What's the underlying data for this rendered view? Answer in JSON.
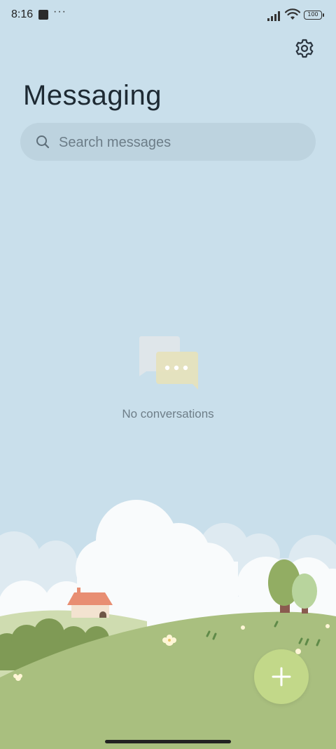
{
  "status_bar": {
    "time": "8:16",
    "more": "···",
    "battery": "100"
  },
  "header": {
    "title": "Messaging"
  },
  "search": {
    "placeholder": "Search messages"
  },
  "empty_state": {
    "text": "No conversations"
  },
  "icons": {
    "settings": "gear-icon",
    "search": "search-icon",
    "compose": "plus-icon",
    "empty": "chat-bubbles-icon"
  },
  "colors": {
    "background": "#c9dfeb",
    "search_bg": "#bdd3df",
    "fab": "#c2d889",
    "hill": "#a9bf7f"
  }
}
